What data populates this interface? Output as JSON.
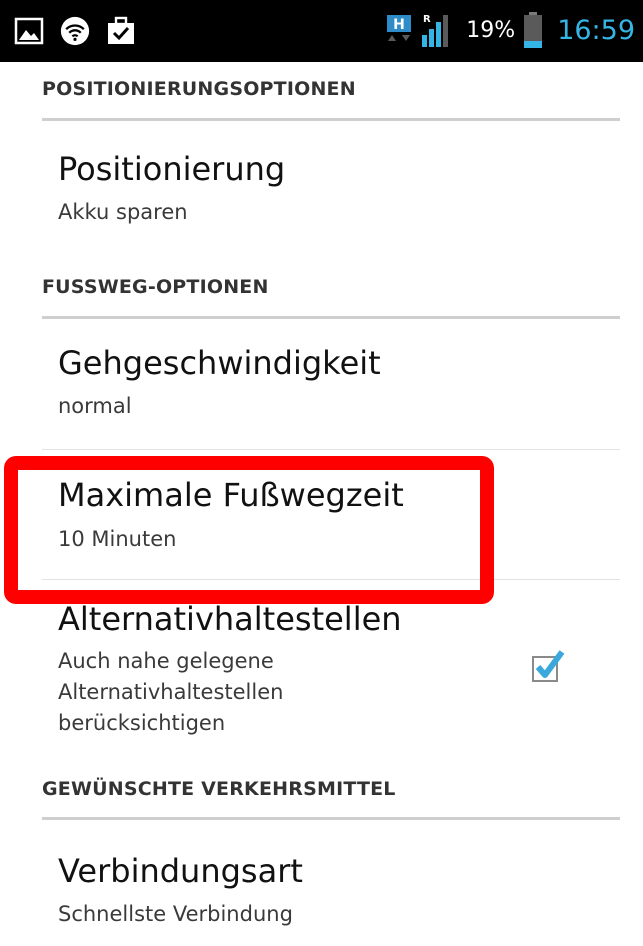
{
  "status_bar": {
    "battery_percent": "19%",
    "time": "16:59",
    "icons": [
      "image-icon",
      "wifi-icon",
      "briefcase-check-icon",
      "hspa-icon",
      "signal-icon",
      "battery-icon"
    ],
    "hspa_label": "H",
    "roaming_label": "R",
    "time_color": "#35b5e5"
  },
  "sections": {
    "positioning_header": "POSITIONIERUNGSOPTIONEN",
    "walking_header": "FUSSWEG-OPTIONEN",
    "transport_header": "GEWÜNSCHTE VERKEHRSMITTEL"
  },
  "prefs": {
    "positioning": {
      "title": "Positionierung",
      "summary": "Akku sparen"
    },
    "walking_speed": {
      "title": "Gehgeschwindigkeit",
      "summary": "normal"
    },
    "max_walk_time": {
      "title": "Maximale Fußwegzeit",
      "summary": "10 Minuten"
    },
    "alternative_stops": {
      "title": "Alternativhaltestellen",
      "summary_line1": "Auch nahe gelegene",
      "summary_line2": "Alternativhaltestellen",
      "summary_line3": "berücksichtigen",
      "checked": true
    },
    "connection_type": {
      "title": "Verbindungsart",
      "summary": "Schnellste Verbindung"
    }
  },
  "colors": {
    "highlight": "#ff0000",
    "checkbox_check": "#3aa8dc"
  }
}
